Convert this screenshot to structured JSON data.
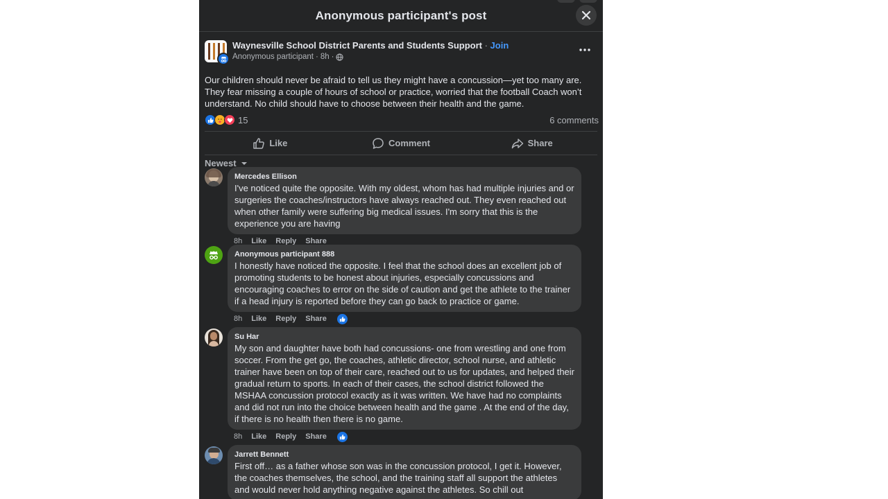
{
  "header": {
    "title": "Anonymous participant's post"
  },
  "post": {
    "group_name": "Waynesville School District Parents and Students Support",
    "separator": " · ",
    "join_label": "Join",
    "author": "Anonymous participant",
    "time": "8h",
    "body": "Our children should never be afraid to tell us they might have a concussion—yet too many are. They fear missing a couple of hours of school or practice, worried that the football Coach won’t understand. No child should have to choose between their health and the game.",
    "reaction_count": "15",
    "comments_count": "6 comments"
  },
  "actions": {
    "like": "Like",
    "comment": "Comment",
    "share": "Share"
  },
  "sort": {
    "label": "Newest"
  },
  "comments": [
    {
      "author": "Mercedes Ellison",
      "text": "I've noticed quite the opposite. With my oldest, whom has had multiple injuries and or surgeries the coaches/instructors have always reached out. They even reached out when other family were suffering big medical issues. I'm sorry that this is the experience you are having",
      "time": "8h",
      "like": "Like",
      "reply": "Reply",
      "share": "Share"
    },
    {
      "author": "Anonymous participant 888",
      "text": "I honestly have noticed the opposite. I feel that the school does an excellent job of promoting students to be honest about injuries, especially concussions and encouraging coaches to error on the side of caution and get the athlete to the trainer if a head injury is reported before they can go back to practice or game.",
      "time": "8h",
      "like": "Like",
      "reply": "Reply",
      "share": "Share"
    },
    {
      "author": "Su Har",
      "text": "My son and daughter have both had concussions- one from wrestling and one from soccer. From the get go, the coaches, athletic director, school nurse, and athletic trainer have been on top of their care, reached out to us for updates, and helped their gradual return to sports. In each of their cases, the school district followed the MSHAA concussion protocol exactly as it was written. We have had no complaints and did not run into the choice between health and the game . At the end of the day, if there is no health then there is no game.",
      "time": "8h",
      "like": "Like",
      "reply": "Reply",
      "share": "Share"
    },
    {
      "author": "Jarrett Bennett",
      "text": "First off… as a father whose son was in the concussion protocol, I get it. However, the coaches themselves, the school, and the training staff all support the athletes and would never hold anything negative against the athletes. So chill out"
    }
  ],
  "colors": {
    "modal_bg": "#242526",
    "bubble_bg": "#3a3b3c",
    "primary_text": "#e4e6eb",
    "secondary_text": "#b0b3b8",
    "link_blue": "#4599ff",
    "like_blue": "#1b74e4"
  },
  "icons": {
    "close": "close-icon",
    "more": "more-options-icon",
    "globe": "globe-icon",
    "like": "thumbs-up-icon",
    "comment": "comment-bubble-icon",
    "share": "share-arrow-icon",
    "sort": "caret-down-icon"
  }
}
